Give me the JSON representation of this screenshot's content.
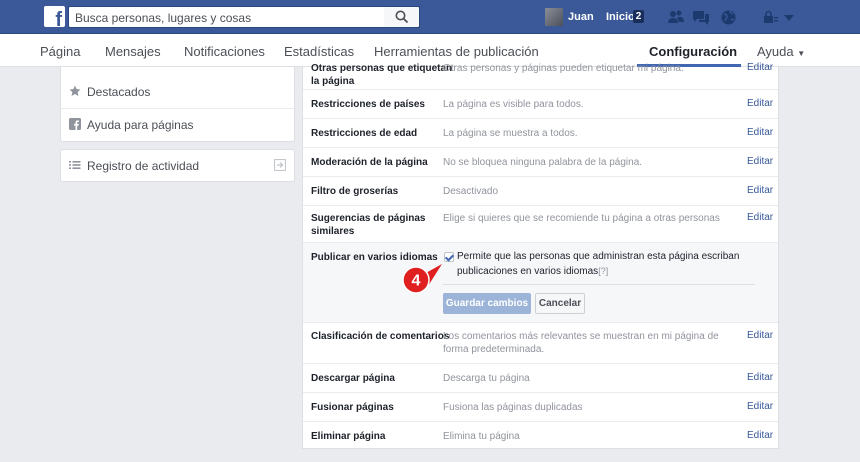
{
  "topbar": {
    "logo": "f",
    "search_placeholder": "Busca personas, lugares y cosas",
    "user_name": "Juan",
    "home_label": "Inicio",
    "home_badge": "2",
    "icons": [
      "friends-icon",
      "messages-icon",
      "globe-icon",
      "lock-icon",
      "dropdown-icon"
    ]
  },
  "pagenav": {
    "items": [
      "Página",
      "Mensajes",
      "Notificaciones",
      "Estadísticas",
      "Herramientas de publicación",
      "Configuración",
      "Ayuda"
    ],
    "active": "Configuración"
  },
  "sidebar": {
    "card1": [
      {
        "label": "Destacados",
        "icon": "star-icon"
      },
      {
        "label": "Ayuda para páginas",
        "icon": "facebook-icon"
      }
    ],
    "card2": [
      {
        "label": "Registro de actividad",
        "icon": "list-icon",
        "action_icon": "export-icon"
      }
    ]
  },
  "settings": {
    "edit_label": "Editar",
    "rows": [
      {
        "label": "Otras personas que etiquetan la página",
        "label_l1": "Otras personas que etiquetan",
        "label_l2": "la página",
        "value": "Otras personas y páginas pueden etiquetar mi página."
      },
      {
        "label": "Restricciones de países",
        "value": "La página es visible para todos."
      },
      {
        "label": "Restricciones de edad",
        "value": "La página se muestra a todos."
      },
      {
        "label": "Moderación de la página",
        "value": "No se bloquea ninguna palabra de la página."
      },
      {
        "label": "Filtro de groserías",
        "value": "Desactivado"
      },
      {
        "label": "Sugerencias de páginas similares",
        "label_l1": "Sugerencias de páginas",
        "label_l2": "similares",
        "value": "Elige si quieres que se recomiende tu página a otras personas"
      },
      {
        "label": "Clasificación de comentarios",
        "value_l1": "Los comentarios más relevantes se muestran en mi página de",
        "value_l2": "forma predeterminada."
      },
      {
        "label": "Descargar página",
        "value": "Descarga tu página"
      },
      {
        "label": "Fusionar páginas",
        "value": "Fusiona las páginas duplicadas"
      },
      {
        "label": "Eliminar página",
        "value": "Elimina tu página"
      }
    ],
    "expanded": {
      "label": "Publicar en varios idiomas",
      "checkbox_checked": true,
      "text_l1": "Permite que las personas que administran esta página escriban",
      "text_l2": "publicaciones en varios idiomas",
      "help": "[?]",
      "save_button": "Guardar cambios",
      "cancel_button": "Cancelar"
    }
  },
  "annotation": {
    "step_number": "4",
    "color": "#e02020"
  }
}
